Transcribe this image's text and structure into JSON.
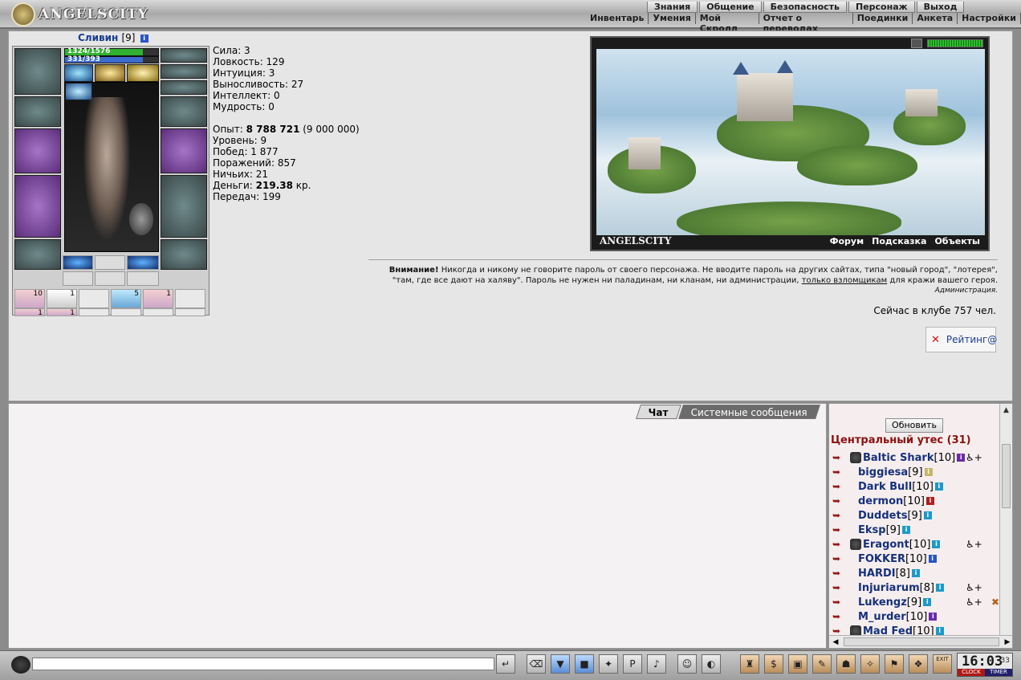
{
  "app": {
    "title": "ANGELSCITY"
  },
  "menu": {
    "top": [
      "Знания",
      "Общение",
      "Безопасность",
      "Персонаж",
      "Выход"
    ],
    "sub": [
      "Инвентарь",
      "Умения",
      "Мой Скролл",
      "Отчет о переводах",
      "Поединки",
      "Анкета",
      "Настройки"
    ]
  },
  "character": {
    "name": "Сливин",
    "level": "[9]",
    "hp": "1324/1576",
    "hp_fraction": 0.84,
    "mp": "331/393",
    "mp_fraction": 0.84,
    "scroll_counts": [
      "10",
      "1",
      "5",
      "1",
      "1",
      "1"
    ]
  },
  "stats": {
    "strength": "Сила: 3",
    "agility": "Ловкость: 129",
    "intuition": "Интуиция: 3",
    "endurance": "Выносливость: 27",
    "intellect": "Интеллект: 0",
    "wisdom": "Мудрость: 0",
    "exp_label": "Опыт: ",
    "exp_value": "8 788 721",
    "exp_next": " (9 000 000)",
    "level": "Уровень: 9",
    "wins": "Побед: 1 877",
    "losses": "Поражений: 857",
    "draws": "Ничьих: 21",
    "money_label": "Деньги: ",
    "money_value": "219.38",
    "money_unit": " кр.",
    "transfers": "Передач: 199"
  },
  "scene": {
    "title": "ANGELSCITY",
    "links": [
      "Форум",
      "Подсказка",
      "Объекты"
    ],
    "progress": 1.0
  },
  "notice": {
    "attention": "Внимание!",
    "text1": " Никогда и никому не говорите пароль от своего персонажа. Не вводите пароль на других сайтах, типа \"новый город\", \"лотерея\", \"там, где все дают на халяву\". Пароль не нужен ни паладинам, ни кланам, ни администрации, ",
    "link": "только взломщикам",
    "text2": " для кражи вашего героя.",
    "signature": "Администрация."
  },
  "online": "Сейчас в клубе 757 чел.",
  "rating": "Рейтинг@",
  "chat": {
    "tabs": [
      "Чат",
      "Системные сообщения"
    ]
  },
  "users": {
    "refresh_label": "Обновить",
    "room": "Центральный утес (31)",
    "list": [
      {
        "nick": "Baltic Shark",
        "level": "[10]",
        "info_color": "#6c2aa8",
        "pre_icon": "bat-icon",
        "extra": "♿+"
      },
      {
        "nick": "biggiesa",
        "level": "[9]",
        "info_color": "#c5b66a"
      },
      {
        "nick": "Dark Bull",
        "level": "[10]",
        "info_color": "#1d9ac9"
      },
      {
        "nick": "dermon",
        "level": "[10]",
        "info_color": "#b01f1f"
      },
      {
        "nick": "Duddets",
        "level": "[9]",
        "info_color": "#1d9ac9"
      },
      {
        "nick": "Eksp",
        "level": "[9]",
        "info_color": "#1d9ac9"
      },
      {
        "nick": "Eragont",
        "level": "[10]",
        "info_color": "#1d9ac9",
        "pre_icon": "clan-shield-icon",
        "extra": "♿+"
      },
      {
        "nick": "FOKKER",
        "level": "[10]",
        "info_color": "#2a55c9"
      },
      {
        "nick": "HARDI",
        "level": "[8]",
        "info_color": "#1d9ac9"
      },
      {
        "nick": "Injuriarum",
        "level": "[8]",
        "info_color": "#1d9ac9",
        "extra": "♿+"
      },
      {
        "nick": "Lukengz",
        "level": "[9]",
        "info_color": "#1d9ac9",
        "extra": "♿+",
        "extra2": "✖"
      },
      {
        "nick": "M_urder",
        "level": "[10]",
        "info_color": "#6c2aa8"
      },
      {
        "nick": "Mad Fed",
        "level": "[10]",
        "info_color": "#1d9ac9",
        "pre_icon": "hat-icon"
      }
    ]
  },
  "bottombar": {
    "clock_time": "16:03",
    "clock_seconds": "33",
    "clock_label": "CLOCK",
    "timer_label": "TIMER",
    "exit_label": "EXIT"
  }
}
